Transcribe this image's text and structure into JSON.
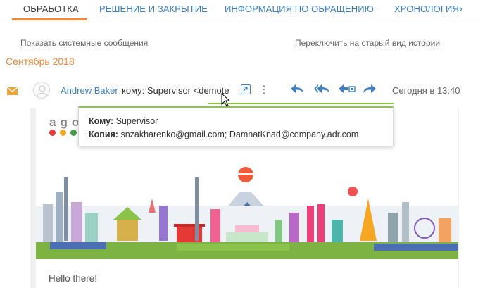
{
  "tabs": [
    {
      "label": "ОБРАБОТКА",
      "active": true
    },
    {
      "label": "РЕШЕНИЕ И ЗАКРЫТИЕ",
      "active": false
    },
    {
      "label": "ИНФОРМАЦИЯ ПО ОБРАЩЕНИЮ",
      "active": false
    },
    {
      "label": "ХРОНОЛОГИЯ",
      "active": false
    }
  ],
  "links": {
    "system_messages": "Показать системные сообщения",
    "old_history": "Переключить на старый вид истории"
  },
  "month_group": "Сентябрь 2018",
  "message": {
    "author": "Andrew Baker",
    "to_prefix": "кому: Supervisor <demote",
    "date": "Сегодня в 13:40",
    "icons": {
      "type": "envelope-icon",
      "open": "open-external-icon",
      "more": "more-vertical-icon",
      "actions": [
        "reply-icon",
        "reply-all-icon",
        "reply-with-attachment-icon",
        "forward-icon"
      ]
    }
  },
  "recipients_popup": {
    "to_label": "Кому:",
    "to_value": "Supervisor",
    "cc_label": "Копия:",
    "cc_value": "snzakharenko@gmail.com; DamnatKnad@company.adr.com"
  },
  "email_body": {
    "logo_text": "ago",
    "greeting": "Hello there!"
  },
  "colors": {
    "accent_orange": "#f08a3a",
    "link_blue": "#3b80c6",
    "success_green": "#8cc63f"
  }
}
